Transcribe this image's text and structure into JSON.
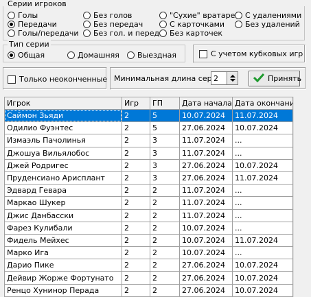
{
  "series_group": {
    "title": "Серии игроков",
    "options": [
      {
        "label": "Голы",
        "checked": false
      },
      {
        "label": "Передачи",
        "checked": true
      },
      {
        "label": "Голы/передачи",
        "checked": false
      },
      {
        "label": "Без голов",
        "checked": false
      },
      {
        "label": "Без передач",
        "checked": false
      },
      {
        "label": "Без гол. и перед.",
        "checked": false
      },
      {
        "label": "\"Сухие\" вратарей",
        "checked": false
      },
      {
        "label": "С карточками",
        "checked": false
      },
      {
        "label": "Без карточек",
        "checked": false
      },
      {
        "label": "С удалениями",
        "checked": false
      },
      {
        "label": "Без удалений",
        "checked": false
      }
    ]
  },
  "type_group": {
    "title": "Тип серии",
    "options": [
      {
        "label": "Общая",
        "checked": true
      },
      {
        "label": "Домашняя",
        "checked": false
      },
      {
        "label": "Выездная",
        "checked": false
      }
    ]
  },
  "cup_games_label": "С учетом кубковых игр",
  "unfinished_label": "Только неоконченные",
  "min_length_label": "Минимальная длина серии",
  "min_length_value": "2",
  "accept_label": "Принять",
  "table": {
    "columns": [
      "Игрок",
      "Игр",
      "ГП",
      "Дата начала",
      "Дата окончания"
    ],
    "rows": [
      [
        "Саймон Зьяди",
        "2",
        "5",
        "10.07.2024",
        "11.07.2024"
      ],
      [
        "Одилио Фуэнтес",
        "2",
        "5",
        "27.06.2024",
        "10.07.2024"
      ],
      [
        "Измаэль Пачолинья",
        "2",
        "3",
        "11.07.2024",
        "..."
      ],
      [
        "Джошуа Вильялобос",
        "2",
        "3",
        "11.07.2024",
        "..."
      ],
      [
        "Джей Родригес",
        "2",
        "3",
        "27.06.2024",
        "10.07.2024"
      ],
      [
        "Пруденсиано Арисплант",
        "2",
        "3",
        "27.06.2024",
        "11.07.2024"
      ],
      [
        "Эдвард Гевара",
        "2",
        "2",
        "11.07.2024",
        "..."
      ],
      [
        "Маркао Шукер",
        "2",
        "2",
        "11.07.2024",
        "..."
      ],
      [
        "Джис Данбасски",
        "2",
        "2",
        "11.07.2024",
        "..."
      ],
      [
        "Фарез Кулибали",
        "2",
        "2",
        "10.07.2024",
        "..."
      ],
      [
        "Фидель Мейхес",
        "2",
        "2",
        "10.07.2024",
        "11.07.2024"
      ],
      [
        "Марко Ига",
        "2",
        "2",
        "10.07.2024",
        "..."
      ],
      [
        "Дарио Пике",
        "2",
        "2",
        "27.06.2024",
        "10.07.2024"
      ],
      [
        "Дейвир Жорже Фортунато",
        "2",
        "2",
        "27.06.2024",
        "10.07.2024"
      ],
      [
        "Ренцо Хунинор Перада",
        "2",
        "2",
        "27.06.2024",
        "10.07.2024"
      ]
    ],
    "selected_row": 0
  }
}
